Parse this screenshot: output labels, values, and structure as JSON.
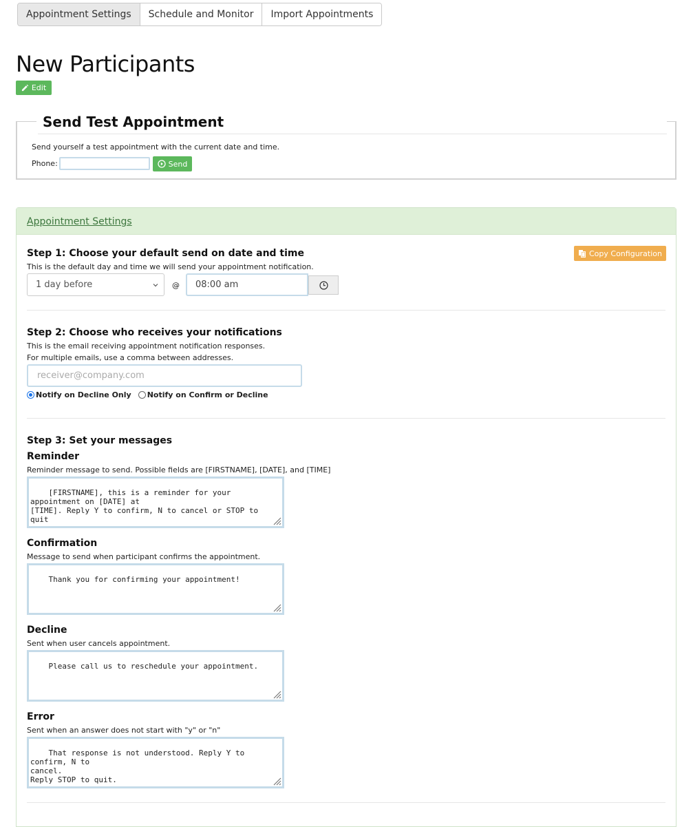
{
  "tabs": [
    {
      "label": "Appointment Settings"
    },
    {
      "label": "Schedule and Monitor"
    },
    {
      "label": "Import Appointments"
    }
  ],
  "page": {
    "title": "New Participants",
    "edit_label": "Edit"
  },
  "test": {
    "legend": "Send Test Appointment",
    "description": "Send yourself a test appointment with the current date and time.",
    "phone_label": "Phone:",
    "phone_value": "",
    "send_label": "Send"
  },
  "panel": {
    "title": "Appointment Settings",
    "copy_label": "Copy Configuration"
  },
  "step1": {
    "title": "Step 1: Choose your default send on date and time",
    "description": "This is the default day and time we will send your appointment notification.",
    "send_day": "1 day before",
    "at": "@",
    "time": "08:00 am"
  },
  "step2": {
    "title": "Step 2: Choose who receives your notifications",
    "description1": "This is the email receiving appointment notification responses.",
    "description2": "For multiple emails, use a comma between addresses.",
    "email_placeholder": "receiver@company.com",
    "radio_decline_only": "Notify on Decline Only",
    "radio_confirm_or_decline": "Notify on Confirm or Decline"
  },
  "step3": {
    "title": "Step 3: Set your messages",
    "reminder": {
      "title": "Reminder",
      "description": "Reminder message to send. Possible fields are [FIRSTNAME], [DATE], and [TIME]",
      "text": "[FIRSTNAME], this is a reminder for your appointment on [DATE] at\n[TIME]. Reply Y to confirm, N to cancel or STOP to quit"
    },
    "confirmation": {
      "title": "Confirmation",
      "description": "Message to send when participant confirms the appointment.",
      "text": "Thank you for confirming your appointment!"
    },
    "decline": {
      "title": "Decline",
      "description": "Sent when user cancels appointment.",
      "text": "Please call us to reschedule your appointment."
    },
    "error": {
      "title": "Error",
      "description": "Sent when an answer does not start with \"y\" or \"n\"",
      "text": "That response is not understood. Reply Y to confirm, N to\ncancel.\nReply STOP to quit."
    }
  },
  "colors": {
    "success": "#5cb85c",
    "warning": "#f0ad4e",
    "panel_header": "#dff0d8",
    "panel_title": "#3c763d",
    "input_border": "#c5dbe9"
  }
}
